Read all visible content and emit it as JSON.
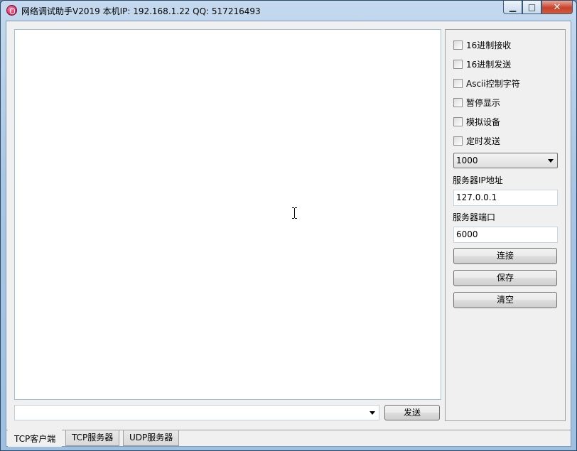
{
  "window": {
    "title": "网络调试助手V2019  本机IP: 192.168.1.22  QQ: 517216493",
    "minimize_glyph": "▁",
    "maximize_glyph": "□",
    "close_glyph": "✕"
  },
  "options": {
    "checkboxes": [
      {
        "label": "16进制接收",
        "checked": false
      },
      {
        "label": "16进制发送",
        "checked": false
      },
      {
        "label": "Ascii控制字符",
        "checked": false
      },
      {
        "label": "暂停显示",
        "checked": false
      },
      {
        "label": "模拟设备",
        "checked": false
      },
      {
        "label": "定时发送",
        "checked": false
      }
    ],
    "interval_value": "1000",
    "server_ip_label": "服务器IP地址",
    "server_ip_value": "127.0.0.1",
    "server_port_label": "服务器端口",
    "server_port_value": "6000",
    "connect_label": "连接",
    "save_label": "保存",
    "clear_label": "清空"
  },
  "send": {
    "input_value": "",
    "send_label": "发送"
  },
  "tabs": [
    {
      "label": "TCP客户端",
      "active": true
    },
    {
      "label": "TCP服务器",
      "active": false
    },
    {
      "label": "UDP服务器",
      "active": false
    }
  ],
  "colors": {
    "titlebar": "#a9c6e3",
    "close_button": "#c7412a",
    "client_bg": "#f0f0f0"
  },
  "icons": [
    "app-icon",
    "i-beam-cursor-icon",
    "dropdown-arrow-icon"
  ]
}
